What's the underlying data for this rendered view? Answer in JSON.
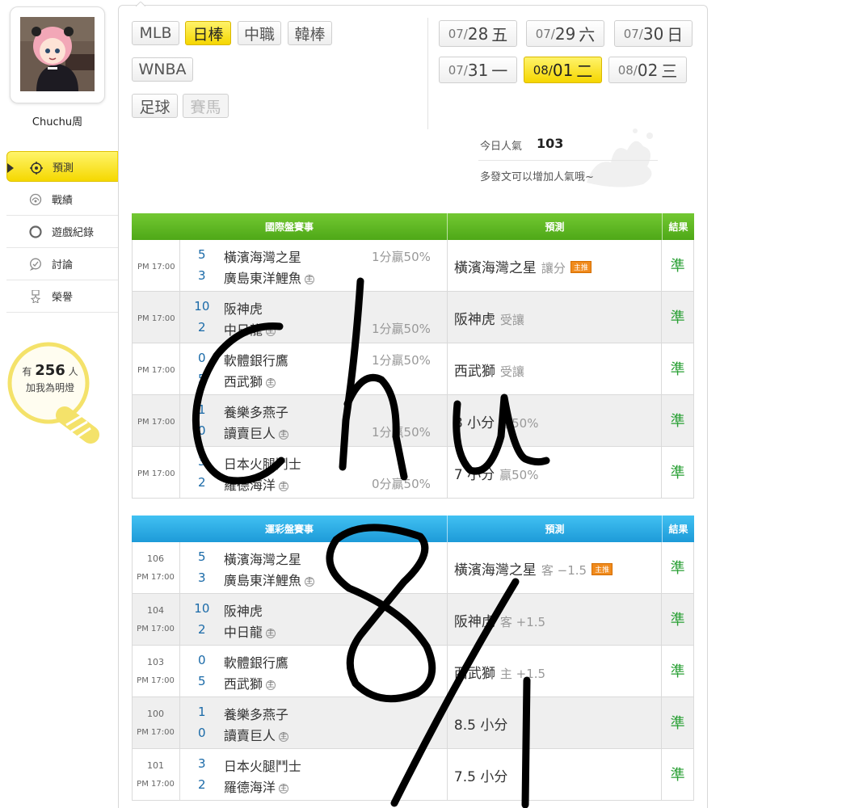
{
  "profile": {
    "name": "Chuchu周"
  },
  "nav": [
    {
      "label": "預測",
      "icon": "target-icon",
      "active": true
    },
    {
      "label": "戰績",
      "icon": "record-icon"
    },
    {
      "label": "遊戲紀錄",
      "icon": "circle-icon"
    },
    {
      "label": "討論",
      "icon": "chat-icon"
    },
    {
      "label": "榮譽",
      "icon": "medal-icon"
    }
  ],
  "bulb": {
    "prefix": "有",
    "count": "256",
    "suffix": "人",
    "caption": "加我為明燈"
  },
  "sports": [
    "MLB",
    "日棒",
    "中職",
    "韓棒",
    "WNBA",
    "足球",
    "賽馬"
  ],
  "dates": [
    {
      "md": "07/",
      "d": "28",
      "wd": "五"
    },
    {
      "md": "07/",
      "d": "29",
      "wd": "六"
    },
    {
      "md": "07/",
      "d": "30",
      "wd": "日"
    },
    {
      "md": "07/",
      "d": "31",
      "wd": "一"
    },
    {
      "md": "08/",
      "d": "01",
      "wd": "二"
    },
    {
      "md": "08/",
      "d": "02",
      "wd": "三"
    }
  ],
  "popularity": {
    "label": "今日人氣",
    "value": "103",
    "hint": "多發文可以增加人氣哦~"
  },
  "intl": {
    "headers": [
      "國際盤賽事",
      "預測",
      "結果"
    ],
    "rows": [
      {
        "time": "PM 17:00",
        "s1": "5",
        "t1": "橫濱海灣之星",
        "s2": "3",
        "t2": "廣島東洋鯉魚",
        "odds": "1分贏50%",
        "odds_row": 1,
        "pred": "橫濱海灣之星",
        "sub": "讓分",
        "tag": "主推",
        "res": "準"
      },
      {
        "time": "PM 17:00",
        "s1": "10",
        "t1": "阪神虎",
        "s2": "2",
        "t2": "中日龍",
        "odds": "1分贏50%",
        "odds_row": 2,
        "pred": "阪神虎",
        "sub": "受讓",
        "tag": "",
        "res": "準"
      },
      {
        "time": "PM 17:00",
        "s1": "0",
        "t1": "軟體銀行鷹",
        "s2": "5",
        "t2": "西武獅",
        "odds": "1分贏50%",
        "odds_row": 1,
        "pred": "西武獅",
        "sub": "受讓",
        "tag": "",
        "res": "準"
      },
      {
        "time": "PM 17:00",
        "s1": "1",
        "t1": "養樂多燕子",
        "s2": "0",
        "t2": "讀賣巨人",
        "odds": "1分贏50%",
        "odds_row": 2,
        "pred": "8 小分",
        "sub": "贏50%",
        "tag": "",
        "res": "準"
      },
      {
        "time": "PM 17:00",
        "s1": "3",
        "t1": "日本火腿鬥士",
        "s2": "2",
        "t2": "羅德海洋",
        "odds": "0分贏50%",
        "odds_row": 2,
        "pred": "7 小分",
        "sub": "贏50%",
        "tag": "",
        "res": "準"
      }
    ]
  },
  "sport_lottery": {
    "headers": [
      "運彩盤賽事",
      "預測",
      "結果"
    ],
    "rows": [
      {
        "num": "106",
        "time": "PM 17:00",
        "s1": "5",
        "t1": "橫濱海灣之星",
        "s2": "3",
        "t2": "廣島東洋鯉魚",
        "pred": "橫濱海灣之星",
        "sub": "客 −1.5",
        "tag": "主推",
        "res": "準"
      },
      {
        "num": "104",
        "time": "PM 17:00",
        "s1": "10",
        "t1": "阪神虎",
        "s2": "2",
        "t2": "中日龍",
        "pred": "阪神虎",
        "sub": "客 +1.5",
        "tag": "",
        "res": "準"
      },
      {
        "num": "103",
        "time": "PM 17:00",
        "s1": "0",
        "t1": "軟體銀行鷹",
        "s2": "5",
        "t2": "西武獅",
        "pred": "西武獅",
        "sub": "主 +1.5",
        "tag": "",
        "res": "準"
      },
      {
        "num": "100",
        "time": "PM 17:00",
        "s1": "1",
        "t1": "養樂多燕子",
        "s2": "0",
        "t2": "讀賣巨人",
        "pred": "8.5 小分",
        "sub": "",
        "tag": "",
        "res": "準"
      },
      {
        "num": "101",
        "time": "PM 17:00",
        "s1": "3",
        "t1": "日本火腿鬥士",
        "s2": "2",
        "t2": "羅德海洋",
        "pred": "7.5 小分",
        "sub": "",
        "tag": "",
        "res": "準"
      }
    ]
  },
  "home_mark": "主",
  "colors": {
    "active_yellow": "#f5d600",
    "intl_header": "#4ea817",
    "lottery_header": "#1d9ad8",
    "result_green": "#2aa035",
    "score_blue": "#1a6aa8",
    "tag_orange": "#f08a1c"
  }
}
